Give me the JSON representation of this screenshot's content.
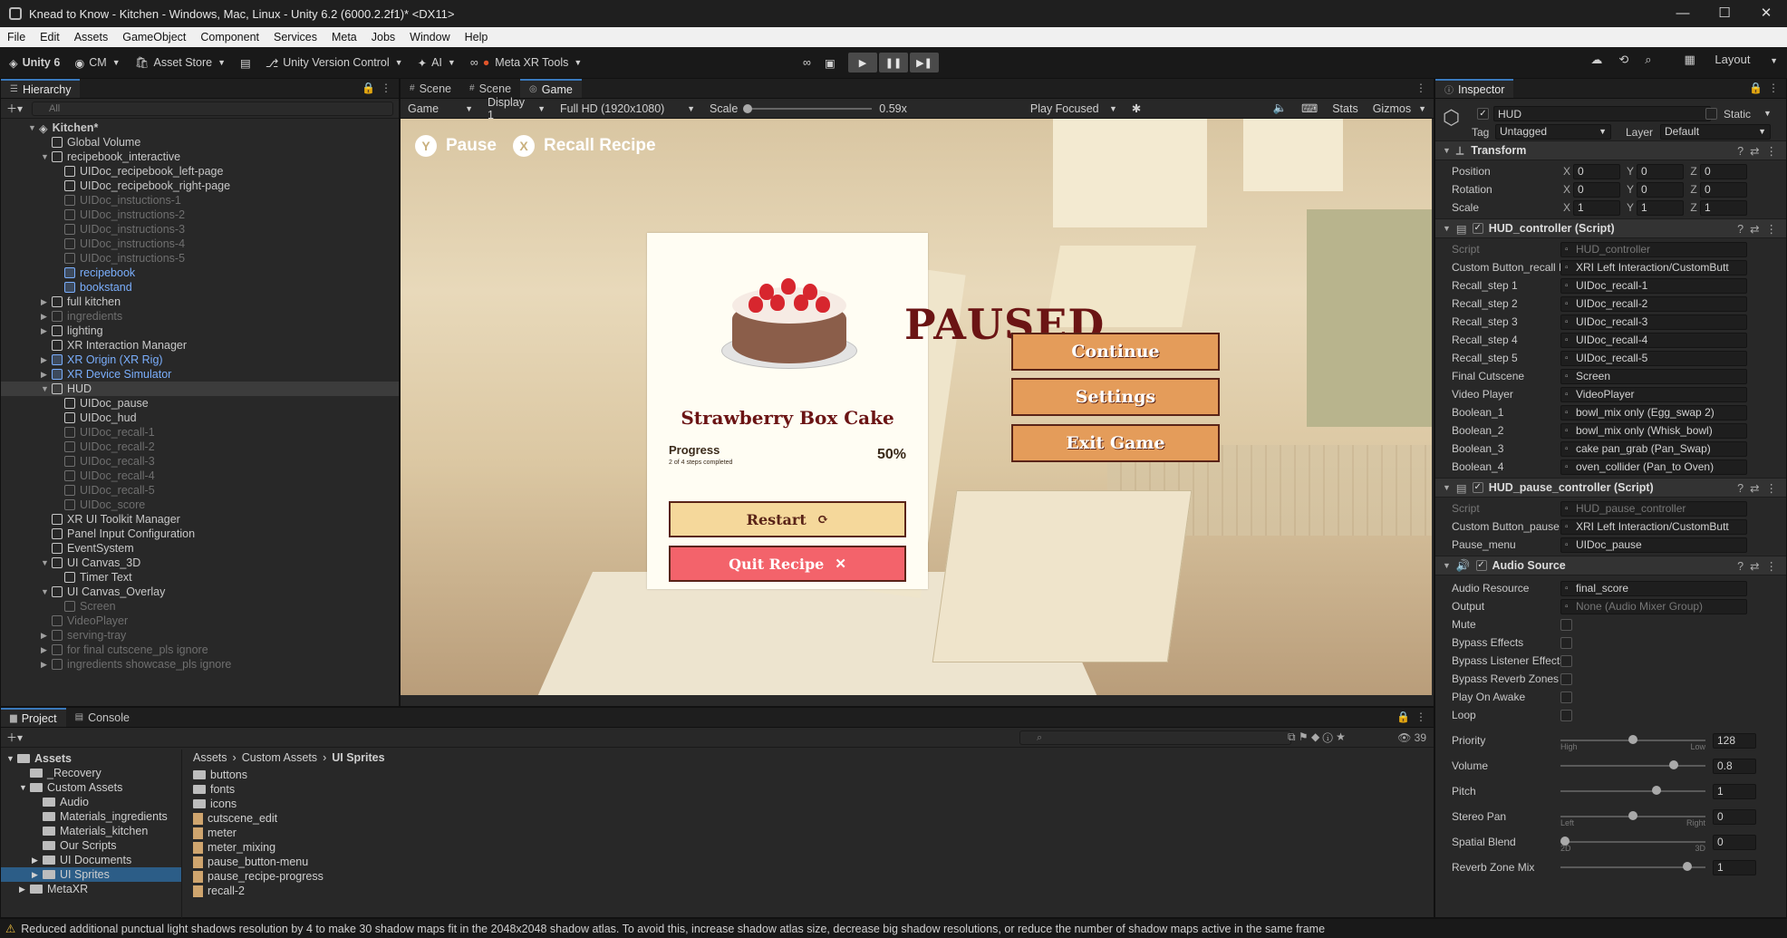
{
  "window": {
    "title": "Knead to Know - Kitchen - Windows, Mac, Linux - Unity 6.2 (6000.2.2f1)* <DX11>",
    "controls": [
      "—",
      "☐",
      "✕"
    ]
  },
  "menubar": [
    "File",
    "Edit",
    "Assets",
    "GameObject",
    "Component",
    "Services",
    "Meta",
    "Jobs",
    "Window",
    "Help"
  ],
  "toolbar": {
    "unity_label": "Unity 6",
    "account": "CM",
    "asset_store": "Asset Store",
    "version_control": "Unity Version Control",
    "ai": "AI",
    "meta_xr": "Meta XR Tools",
    "layout": "Layout"
  },
  "hierarchy": {
    "tab": "Hierarchy",
    "search_placeholder": "All",
    "rows": [
      {
        "label": "Kitchen*",
        "indent": 0,
        "arrow": "▼",
        "style": "scene"
      },
      {
        "label": "Global Volume",
        "indent": 1,
        "arrow": "",
        "style": ""
      },
      {
        "label": "recipebook_interactive",
        "indent": 1,
        "arrow": "▼",
        "style": ""
      },
      {
        "label": "UIDoc_recipebook_left-page",
        "indent": 2,
        "arrow": "",
        "style": ""
      },
      {
        "label": "UIDoc_recipebook_right-page",
        "indent": 2,
        "arrow": "",
        "style": ""
      },
      {
        "label": "UIDoc_instuctions-1",
        "indent": 2,
        "arrow": "",
        "style": "dim"
      },
      {
        "label": "UIDoc_instructions-2",
        "indent": 2,
        "arrow": "",
        "style": "dim"
      },
      {
        "label": "UIDoc_instructions-3",
        "indent": 2,
        "arrow": "",
        "style": "dim"
      },
      {
        "label": "UIDoc_instructions-4",
        "indent": 2,
        "arrow": "",
        "style": "dim"
      },
      {
        "label": "UIDoc_instructions-5",
        "indent": 2,
        "arrow": "",
        "style": "dim"
      },
      {
        "label": "recipebook",
        "indent": 2,
        "arrow": "",
        "style": "blue"
      },
      {
        "label": "bookstand",
        "indent": 2,
        "arrow": "",
        "style": "blue"
      },
      {
        "label": "full kitchen",
        "indent": 1,
        "arrow": "▶",
        "style": ""
      },
      {
        "label": "ingredients",
        "indent": 1,
        "arrow": "▶",
        "style": "dim"
      },
      {
        "label": "lighting",
        "indent": 1,
        "arrow": "▶",
        "style": ""
      },
      {
        "label": "XR Interaction Manager",
        "indent": 1,
        "arrow": "",
        "style": ""
      },
      {
        "label": "XR Origin (XR Rig)",
        "indent": 1,
        "arrow": "▶",
        "style": "blue"
      },
      {
        "label": "XR Device Simulator",
        "indent": 1,
        "arrow": "▶",
        "style": "blue"
      },
      {
        "label": "HUD",
        "indent": 1,
        "arrow": "▼",
        "style": "sel"
      },
      {
        "label": "UIDoc_pause",
        "indent": 2,
        "arrow": "",
        "style": ""
      },
      {
        "label": "UIDoc_hud",
        "indent": 2,
        "arrow": "",
        "style": ""
      },
      {
        "label": "UIDoc_recall-1",
        "indent": 2,
        "arrow": "",
        "style": "dim"
      },
      {
        "label": "UIDoc_recall-2",
        "indent": 2,
        "arrow": "",
        "style": "dim"
      },
      {
        "label": "UIDoc_recall-3",
        "indent": 2,
        "arrow": "",
        "style": "dim"
      },
      {
        "label": "UIDoc_recall-4",
        "indent": 2,
        "arrow": "",
        "style": "dim"
      },
      {
        "label": "UIDoc_recall-5",
        "indent": 2,
        "arrow": "",
        "style": "dim"
      },
      {
        "label": "UIDoc_score",
        "indent": 2,
        "arrow": "",
        "style": "dim"
      },
      {
        "label": "XR UI Toolkit Manager",
        "indent": 1,
        "arrow": "",
        "style": ""
      },
      {
        "label": "Panel Input Configuration",
        "indent": 1,
        "arrow": "",
        "style": ""
      },
      {
        "label": "EventSystem",
        "indent": 1,
        "arrow": "",
        "style": ""
      },
      {
        "label": "UI Canvas_3D",
        "indent": 1,
        "arrow": "▼",
        "style": ""
      },
      {
        "label": "Timer Text",
        "indent": 2,
        "arrow": "",
        "style": ""
      },
      {
        "label": "UI Canvas_Overlay",
        "indent": 1,
        "arrow": "▼",
        "style": ""
      },
      {
        "label": "Screen",
        "indent": 2,
        "arrow": "",
        "style": "dim"
      },
      {
        "label": "VideoPlayer",
        "indent": 1,
        "arrow": "",
        "style": "dim"
      },
      {
        "label": "serving-tray",
        "indent": 1,
        "arrow": "▶",
        "style": "dim"
      },
      {
        "label": "for final cutscene_pls ignore",
        "indent": 1,
        "arrow": "▶",
        "style": "dim"
      },
      {
        "label": "ingredients showcase_pls ignore",
        "indent": 1,
        "arrow": "▶",
        "style": "dim"
      }
    ]
  },
  "center": {
    "tabs": [
      "Scene",
      "Scene",
      "Game"
    ],
    "gamebar": {
      "mode": "Game",
      "display": "Display 1",
      "resolution": "Full HD (1920x1080)",
      "scale_label": "Scale",
      "scale_value": "0.59x",
      "play_focused": "Play Focused",
      "stats": "Stats",
      "gizmos": "Gizmos"
    }
  },
  "game": {
    "hint_pause_key": "Y",
    "hint_pause": "Pause",
    "hint_recall_key": "X",
    "hint_recall": "Recall Recipe",
    "card_title": "Strawberry Box Cake",
    "progress_label": "Progress",
    "progress_sub": "2 of 4 steps completed",
    "progress_pct": "50%",
    "restart": "Restart",
    "restart_icon": "⟳",
    "quit": "Quit Recipe",
    "quit_icon": "✕",
    "paused": "PAUSED",
    "continue": "Continue",
    "settings": "Settings",
    "exit": "Exit Game"
  },
  "inspector": {
    "tab": "Inspector",
    "object_name": "HUD",
    "static": "Static",
    "tag_label": "Tag",
    "tag": "Untagged",
    "layer_label": "Layer",
    "layer": "Default",
    "transform": {
      "title": "Transform",
      "rows": [
        {
          "label": "Position",
          "x": "0",
          "y": "0",
          "z": "0"
        },
        {
          "label": "Rotation",
          "x": "0",
          "y": "0",
          "z": "0"
        },
        {
          "label": "Scale",
          "x": "1",
          "y": "1",
          "z": "1"
        }
      ]
    },
    "hud_controller": {
      "title": "HUD_controller (Script)",
      "rows": [
        {
          "label": "Script",
          "value": "HUD_controller",
          "dim": true
        },
        {
          "label": "Custom Button_recall Re",
          "value": "XRI Left Interaction/CustomButt"
        },
        {
          "label": "Recall_step 1",
          "value": "UIDoc_recall-1"
        },
        {
          "label": "Recall_step 2",
          "value": "UIDoc_recall-2"
        },
        {
          "label": "Recall_step 3",
          "value": "UIDoc_recall-3"
        },
        {
          "label": "Recall_step 4",
          "value": "UIDoc_recall-4"
        },
        {
          "label": "Recall_step 5",
          "value": "UIDoc_recall-5"
        },
        {
          "label": "Final Cutscene",
          "value": "Screen"
        },
        {
          "label": "Video Player",
          "value": "VideoPlayer"
        },
        {
          "label": "Boolean_1",
          "value": "bowl_mix only (Egg_swap 2)"
        },
        {
          "label": "Boolean_2",
          "value": "bowl_mix only (Whisk_bowl)"
        },
        {
          "label": "Boolean_3",
          "value": "cake pan_grab (Pan_Swap)"
        },
        {
          "label": "Boolean_4",
          "value": "oven_collider (Pan_to Oven)"
        }
      ]
    },
    "hud_pause_controller": {
      "title": "HUD_pause_controller (Script)",
      "rows": [
        {
          "label": "Script",
          "value": "HUD_pause_controller",
          "dim": true
        },
        {
          "label": "Custom Button_pause M",
          "value": "XRI Left Interaction/CustomButt"
        },
        {
          "label": "Pause_menu",
          "value": "UIDoc_pause"
        }
      ]
    },
    "audio_source": {
      "title": "Audio Source",
      "resource_label": "Audio Resource",
      "resource": "final_score",
      "output_label": "Output",
      "output": "None (Audio Mixer Group)",
      "checks": [
        "Mute",
        "Bypass Effects",
        "Bypass Listener Effects",
        "Bypass Reverb Zones",
        "Play On Awake",
        "Loop"
      ],
      "sliders": [
        {
          "label": "Priority",
          "value": "128",
          "pos": 0.5,
          "left": "High",
          "right": "Low"
        },
        {
          "label": "Volume",
          "value": "0.8",
          "pos": 0.8
        },
        {
          "label": "Pitch",
          "value": "1",
          "pos": 0.67
        },
        {
          "label": "Stereo Pan",
          "value": "0",
          "pos": 0.5,
          "left": "Left",
          "right": "Right"
        },
        {
          "label": "Spatial Blend",
          "value": "0",
          "pos": 0.0,
          "left": "2D",
          "right": "3D"
        },
        {
          "label": "Reverb Zone Mix",
          "value": "1",
          "pos": 0.9
        }
      ]
    }
  },
  "project": {
    "tabs": [
      "Project",
      "Console"
    ],
    "count": "39",
    "tree": [
      {
        "label": "Assets",
        "indent": 0,
        "arrow": "▼"
      },
      {
        "label": "_Recovery",
        "indent": 1,
        "arrow": ""
      },
      {
        "label": "Custom Assets",
        "indent": 1,
        "arrow": "▼"
      },
      {
        "label": "Audio",
        "indent": 2,
        "arrow": ""
      },
      {
        "label": "Materials_ingredients",
        "indent": 2,
        "arrow": ""
      },
      {
        "label": "Materials_kitchen",
        "indent": 2,
        "arrow": ""
      },
      {
        "label": "Our Scripts",
        "indent": 2,
        "arrow": ""
      },
      {
        "label": "UI Documents",
        "indent": 2,
        "arrow": "▶"
      },
      {
        "label": "UI Sprites",
        "indent": 2,
        "arrow": "▶",
        "sel": true
      },
      {
        "label": "MetaXR",
        "indent": 1,
        "arrow": "▶"
      }
    ],
    "breadcrumb": [
      "Assets",
      "Custom Assets",
      "UI Sprites"
    ],
    "files": [
      {
        "label": "buttons",
        "type": "folder"
      },
      {
        "label": "fonts",
        "type": "folder"
      },
      {
        "label": "icons",
        "type": "folder"
      },
      {
        "label": "cutscene_edit",
        "type": "file"
      },
      {
        "label": "meter",
        "type": "file"
      },
      {
        "label": "meter_mixing",
        "type": "file"
      },
      {
        "label": "pause_button-menu",
        "type": "file"
      },
      {
        "label": "pause_recipe-progress",
        "type": "file"
      },
      {
        "label": "recall-2",
        "type": "file"
      }
    ]
  },
  "status": {
    "message": "Reduced additional punctual light shadows resolution by 4 to make 30 shadow maps fit in the 2048x2048 shadow atlas. To avoid this, increase shadow atlas size, decrease big shadow resolutions, or reduce the number of shadow maps active in the same frame"
  }
}
